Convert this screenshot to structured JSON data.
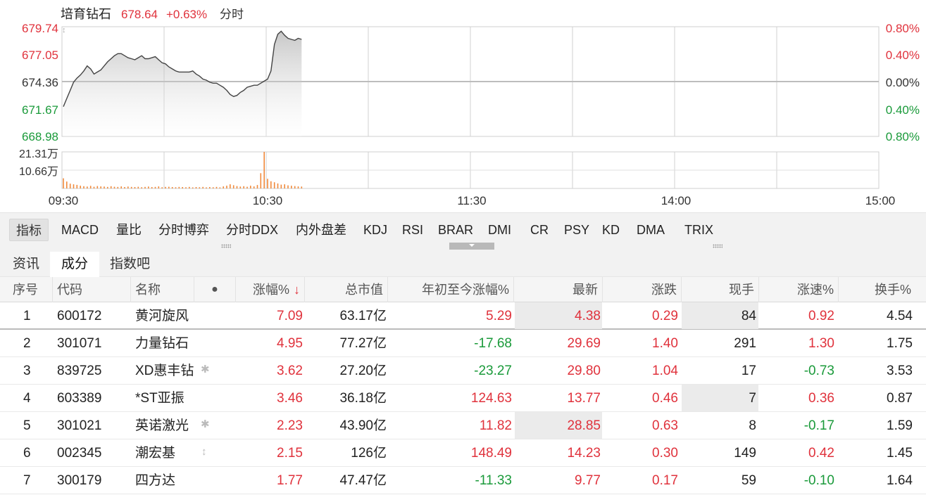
{
  "chart": {
    "stock_name": "培育钻石",
    "price": "678.64",
    "change_pct": "+0.63%",
    "mode": "分时",
    "y_labels_left": [
      "679.74",
      "677.05",
      "674.36",
      "671.67",
      "668.98"
    ],
    "y_labels_right": [
      "0.80%",
      "0.40%",
      "0.00%",
      "0.40%",
      "0.80%"
    ],
    "volume_labels": [
      "21.31万",
      "10.66万"
    ],
    "time_labels": [
      "09:30",
      "10:30",
      "11:30",
      "14:00",
      "15:00"
    ],
    "colors": {
      "up": "#e0323c",
      "down": "#1a9a3a",
      "line": "#444444",
      "volume": "#f08a3c"
    }
  },
  "chart_data": {
    "type": "line",
    "ylim": [
      668.98,
      679.74
    ],
    "x": [
      "09:30",
      "09:31",
      "09:32",
      "09:33",
      "09:34",
      "09:35",
      "09:36",
      "09:37",
      "09:38",
      "09:39",
      "09:40",
      "09:41",
      "09:42",
      "09:43",
      "09:44",
      "09:45",
      "09:46",
      "09:47",
      "09:48",
      "09:49",
      "09:50",
      "09:51",
      "09:52",
      "09:53",
      "09:54",
      "09:55",
      "09:56",
      "09:57",
      "09:58",
      "09:59",
      "10:00",
      "10:01",
      "10:02",
      "10:03",
      "10:04",
      "10:05",
      "10:06",
      "10:07",
      "10:08",
      "10:09",
      "10:10",
      "10:11",
      "10:12",
      "10:13",
      "10:14",
      "10:15",
      "10:16",
      "10:17",
      "10:18",
      "10:19",
      "10:20",
      "10:21",
      "10:22",
      "10:23",
      "10:24",
      "10:25",
      "10:26",
      "10:27",
      "10:28",
      "10:29",
      "10:30",
      "10:31",
      "10:32",
      "10:33",
      "10:34",
      "10:35",
      "10:36",
      "10:37",
      "10:38",
      "10:39",
      "10:40"
    ],
    "values": [
      671.9,
      672.7,
      673.5,
      674.3,
      674.7,
      675.0,
      675.4,
      675.9,
      675.6,
      675.1,
      675.3,
      675.5,
      675.9,
      676.3,
      676.6,
      676.9,
      677.1,
      677.1,
      676.9,
      676.7,
      676.6,
      676.5,
      676.7,
      676.9,
      676.6,
      676.6,
      676.7,
      676.8,
      676.5,
      676.2,
      676.1,
      675.8,
      675.6,
      675.4,
      675.3,
      675.3,
      675.3,
      675.3,
      675.4,
      675.1,
      674.9,
      674.6,
      674.5,
      674.3,
      674.2,
      674.2,
      674.0,
      673.8,
      673.5,
      673.1,
      672.9,
      673.0,
      673.3,
      673.5,
      673.8,
      673.9,
      674.0,
      674.0,
      674.2,
      674.4,
      674.6,
      675.4,
      678.0,
      679.0,
      679.3,
      678.9,
      678.6,
      678.5,
      678.4,
      678.6,
      678.5
    ],
    "volumes": [
      5.9,
      4.0,
      2.8,
      2.4,
      2.1,
      1.6,
      1.3,
      1.1,
      1.5,
      1.0,
      1.4,
      1.2,
      1.1,
      0.9,
      1.3,
      1.0,
      0.9,
      1.2,
      0.8,
      1.1,
      0.9,
      0.8,
      1.0,
      0.7,
      0.9,
      1.1,
      0.8,
      0.9,
      1.2,
      0.7,
      0.9,
      1.0,
      0.8,
      0.7,
      0.9,
      0.8,
      0.7,
      0.9,
      0.6,
      0.8,
      0.7,
      0.9,
      0.6,
      0.8,
      0.7,
      0.9,
      0.6,
      1.2,
      1.6,
      2.4,
      1.9,
      1.4,
      1.1,
      1.3,
      1.0,
      1.6,
      1.2,
      2.0,
      8.9,
      21.31,
      5.6,
      4.2,
      3.6,
      2.9,
      2.2,
      2.4,
      1.8,
      1.6,
      1.4,
      1.2,
      1.1
    ]
  },
  "indicators": [
    "指标",
    "MACD",
    "量比",
    "分时博弈",
    "分时DDX",
    "内外盘差",
    "KDJ",
    "RSI",
    "BRAR",
    "DMI",
    "CR",
    "PSY",
    "KD",
    "DMA",
    "TRIX"
  ],
  "tabs": [
    "资讯",
    "成分",
    "指数吧"
  ],
  "table": {
    "headers": {
      "seq": "序号",
      "code": "代码",
      "name": "名称",
      "dot": "●",
      "pct": "涨幅%",
      "sort": "↓",
      "mktcap": "总市值",
      "ytd": "年初至今涨幅%",
      "last": "最新",
      "chg": "涨跌",
      "vol": "现手",
      "speed": "涨速%",
      "turnover": "换手%"
    },
    "rows": [
      {
        "seq": "1",
        "code": "600172",
        "name": "黄河旋风",
        "mark": "",
        "pct": "7.09",
        "mktcap": "63.17亿",
        "ytd": "5.29",
        "last": "4.38",
        "chg": "0.29",
        "vol": "84",
        "speed": "0.92",
        "turnover": "4.54"
      },
      {
        "seq": "2",
        "code": "301071",
        "name": "力量钻石",
        "mark": "",
        "pct": "4.95",
        "mktcap": "77.27亿",
        "ytd": "-17.68",
        "last": "29.69",
        "chg": "1.40",
        "vol": "291",
        "speed": "1.30",
        "turnover": "1.75"
      },
      {
        "seq": "3",
        "code": "839725",
        "name": "XD惠丰钻",
        "mark": "✱",
        "pct": "3.62",
        "mktcap": "27.20亿",
        "ytd": "-23.27",
        "last": "29.80",
        "chg": "1.04",
        "vol": "17",
        "speed": "-0.73",
        "turnover": "3.53"
      },
      {
        "seq": "4",
        "code": "603389",
        "name": "*ST亚振",
        "mark": "",
        "pct": "3.46",
        "mktcap": "36.18亿",
        "ytd": "124.63",
        "last": "13.77",
        "chg": "0.46",
        "vol": "7",
        "speed": "0.36",
        "turnover": "0.87"
      },
      {
        "seq": "5",
        "code": "301021",
        "name": "英诺激光",
        "mark": "✱",
        "pct": "2.23",
        "mktcap": "43.90亿",
        "ytd": "11.82",
        "last": "28.85",
        "chg": "0.63",
        "vol": "8",
        "speed": "-0.17",
        "turnover": "1.59"
      },
      {
        "seq": "6",
        "code": "002345",
        "name": "潮宏基",
        "mark": "↕",
        "pct": "2.15",
        "mktcap": "126亿",
        "ytd": "148.49",
        "last": "14.23",
        "chg": "0.30",
        "vol": "149",
        "speed": "0.42",
        "turnover": "1.45"
      },
      {
        "seq": "7",
        "code": "300179",
        "name": "四方达",
        "mark": "",
        "pct": "1.77",
        "mktcap": "47.47亿",
        "ytd": "-11.33",
        "last": "9.77",
        "chg": "0.17",
        "vol": "59",
        "speed": "-0.10",
        "turnover": "1.64"
      }
    ]
  }
}
